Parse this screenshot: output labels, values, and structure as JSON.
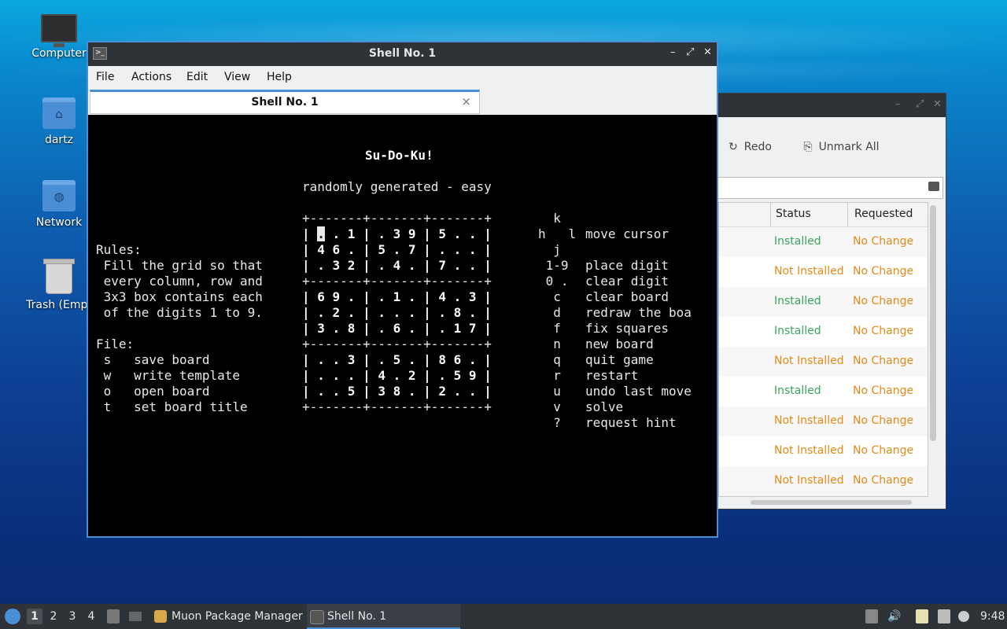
{
  "desktop": {
    "icons": [
      {
        "label": "Computer",
        "icon": "computer-icon"
      },
      {
        "label": "dartz",
        "icon": "home-folder-icon"
      },
      {
        "label": "Network",
        "icon": "network-folder-icon"
      },
      {
        "label": "Trash (Empt",
        "icon": "trash-icon"
      }
    ]
  },
  "terminal": {
    "window_title": "Shell No. 1",
    "menu": [
      "File",
      "Actions",
      "Edit",
      "View",
      "Help"
    ],
    "tab_label": "Shell No. 1",
    "tab_close": "×",
    "controls": {
      "minimize": "–",
      "maximize": "⤢",
      "close": "✕"
    },
    "screen": {
      "game_title": "Su-Do-Ku!",
      "subtitle": "randomly generated - easy",
      "rules_title": "Rules:",
      "rules": [
        " Fill the grid so that",
        " every column, row and",
        " 3x3 box contains each",
        " of the digits 1 to 9."
      ],
      "file_title": "File:",
      "file_cmds": [
        " s   save board",
        " w   write template",
        " o   open board",
        " t   set board title"
      ],
      "grid_border": "+-------+-------+-------+",
      "grid_rows": [
        {
          "pre": "| ",
          "cur": ".",
          "post": " . 1 | . 3 9 | 5 . . |"
        },
        {
          "pre": "| ",
          "cur": "",
          "post": "4 6 . | 5 . 7 | . . . |"
        },
        {
          "pre": "| ",
          "cur": "",
          "post": ". 3 2 | . 4 . | 7 . . |"
        },
        {
          "pre": "| ",
          "cur": "",
          "post": "6 9 . | . 1 . | 4 . 3 |"
        },
        {
          "pre": "| ",
          "cur": "",
          "post": ". 2 . | . . . | . 8 . |"
        },
        {
          "pre": "| ",
          "cur": "",
          "post": "3 . 8 | . 6 . | . 1 7 |"
        },
        {
          "pre": "| ",
          "cur": "",
          "post": ". . 3 | . 5 . | 8 6 . |"
        },
        {
          "pre": "| ",
          "cur": "",
          "post": ". . . | 4 . 2 | . 5 9 |"
        },
        {
          "pre": "| ",
          "cur": "",
          "post": ". . 5 | 3 8 . | 2 . . |"
        }
      ],
      "keys": [
        {
          "key": "  k",
          "desc": ""
        },
        {
          "key": "h   l",
          "desc": "move cursor"
        },
        {
          "key": "  j",
          "desc": ""
        },
        {
          "key": " 1-9",
          "desc": "place digit"
        },
        {
          "key": " 0 .",
          "desc": "clear digit"
        },
        {
          "key": "  c",
          "desc": "clear board"
        },
        {
          "key": "  d",
          "desc": "redraw the boa"
        },
        {
          "key": "  f",
          "desc": "fix squares"
        },
        {
          "key": "  n",
          "desc": "new board"
        },
        {
          "key": "  q",
          "desc": "quit game"
        },
        {
          "key": "  r",
          "desc": "restart"
        },
        {
          "key": "  u",
          "desc": "undo last move"
        },
        {
          "key": "  v",
          "desc": "solve"
        },
        {
          "key": "  ?",
          "desc": "request hint"
        }
      ]
    }
  },
  "muon": {
    "toolbar": {
      "redo": "Redo",
      "unmark_all": "Unmark All"
    },
    "columns": {
      "status": "Status",
      "requested": "Requested"
    },
    "rows": [
      {
        "status": "Installed",
        "requested": "No Change"
      },
      {
        "status": "Not Installed",
        "requested": "No Change"
      },
      {
        "status": "Installed",
        "requested": "No Change"
      },
      {
        "status": "Installed",
        "requested": "No Change"
      },
      {
        "status": "Not Installed",
        "requested": "No Change"
      },
      {
        "status": "Installed",
        "requested": "No Change"
      },
      {
        "status": "Not Installed",
        "requested": "No Change"
      },
      {
        "status": "Not Installed",
        "requested": "No Change"
      },
      {
        "status": "Not Installed",
        "requested": "No Change"
      }
    ],
    "colors": {
      "installed": "#3aa55d",
      "not_installed": "#e38b1a",
      "no_change": "#e38b1a"
    }
  },
  "taskbar": {
    "workspaces": [
      "1",
      "2",
      "3",
      "4"
    ],
    "tasks": [
      {
        "label": "Muon Package Manager",
        "icon": "muon-icon"
      },
      {
        "label": "Shell No. 1",
        "icon": "terminal-icon"
      }
    ],
    "clock": "9:48"
  }
}
